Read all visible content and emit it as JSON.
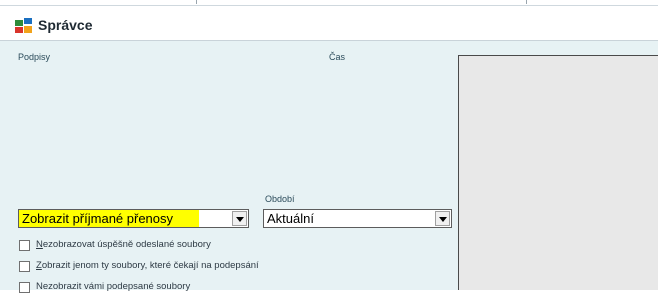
{
  "window": {
    "title": "Správce",
    "icon": "app-icon"
  },
  "labels": {
    "signatures": "Podpisy",
    "time": "Čas",
    "period": "Období"
  },
  "filters": {
    "direction_value": "Zobrazit příjmané přenosy",
    "period_value": "Aktuální"
  },
  "options": [
    {
      "mnemonic": "N",
      "rest": "ezobrazovat úspěšně odeslané soubory",
      "checked": false
    },
    {
      "mnemonic": "Z",
      "rest": "obrazit jenom ty soubory, které čekají na podepsání",
      "checked": false
    },
    {
      "mnemonic": "",
      "rest": "Nezobrazit vámi podepsané soubory",
      "checked": false
    }
  ],
  "colors": {
    "panel_bg": "#e7f2f4",
    "highlight": "#ffff00",
    "preview_bg": "#e8e8e8"
  }
}
